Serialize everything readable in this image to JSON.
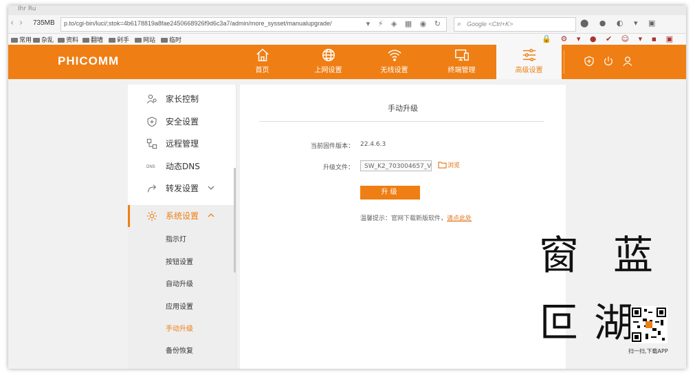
{
  "browser": {
    "tab_text": "Ihr Ru",
    "memory": "735MB",
    "url": "p.to/cgi-bin/luci/;stok=4b6178819a8fae2450668926f9d6c3a7/admin/more_sysset/manualupgrade/",
    "search_placeholder": "Google <Ctrl+K>",
    "bookmarks": [
      "常用",
      "杂乱",
      "资料",
      "翻墙",
      "剁手",
      "网站",
      "临时"
    ]
  },
  "router": {
    "brand": "PHICOMM",
    "nav": [
      {
        "label": "首页",
        "icon": "home-icon"
      },
      {
        "label": "上网设置",
        "icon": "globe-icon"
      },
      {
        "label": "无线设置",
        "icon": "wifi-icon"
      },
      {
        "label": "终端管理",
        "icon": "devices-icon"
      },
      {
        "label": "高级设置",
        "icon": "sliders-icon"
      }
    ],
    "active_nav": "高级设置",
    "accent_color": "#ef7e14"
  },
  "sidebar": {
    "items": [
      {
        "label": "家长控制",
        "icon": "parent-control-icon"
      },
      {
        "label": "安全设置",
        "icon": "shield-icon"
      },
      {
        "label": "远程管理",
        "icon": "remote-icon"
      },
      {
        "label": "动态DNS",
        "icon": "dns-icon"
      },
      {
        "label": "转发设置",
        "icon": "forward-icon"
      },
      {
        "label": "系统设置",
        "icon": "gear-icon"
      }
    ],
    "sub_items": [
      "指示灯",
      "按钮设置",
      "自动升级",
      "应用设置",
      "手动升级",
      "备份恢复"
    ],
    "active_sub": "手动升级"
  },
  "content": {
    "title": "手动升级",
    "firmware_label": "当前固件版本：",
    "firmware_version": "22.4.6.3",
    "file_label": "升级文件：",
    "file_value": "SW_K2_703004657_V",
    "browse_label": "浏览",
    "upgrade_button": "升级",
    "hint_text": "温馨提示：官网下载新版软件，",
    "hint_link": "请点此处"
  },
  "watermark": {
    "chars": [
      "窗",
      "蓝",
      "叵",
      "湖"
    ],
    "caption": "扫一扫,下载APP"
  }
}
